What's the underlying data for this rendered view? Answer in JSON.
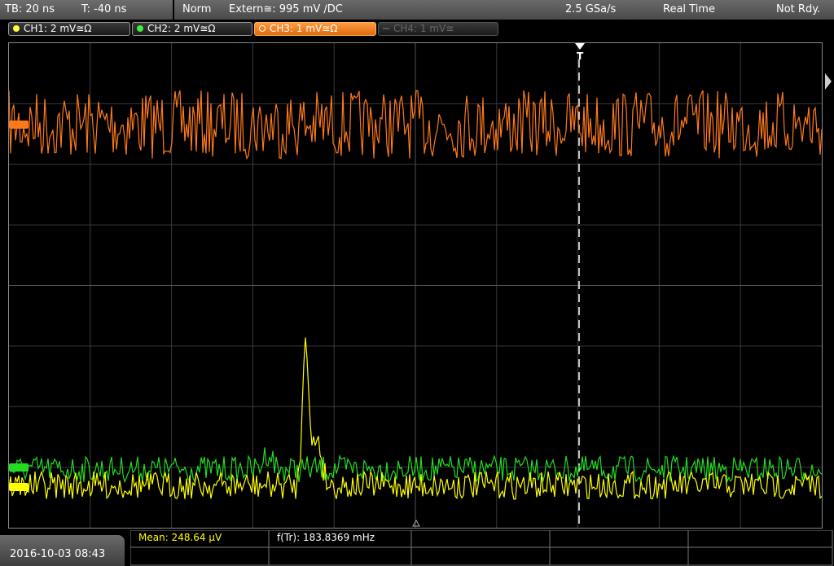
{
  "status_bar": {
    "timebase": "TB: 20 ns",
    "trigger_time": "T: -40 ns",
    "trigger_mode": "Norm",
    "trigger_source": "Extern≅: 995 mV ∕DC",
    "sample_rate": "2.5 GSa/s",
    "acq_mode": "Real Time",
    "trigger_state": "Not Rdy."
  },
  "channels": [
    {
      "label": "CH1: 2 mV≅Ω",
      "color": "#ffff00",
      "state": "on"
    },
    {
      "label": "CH2: 2 mV≅Ω",
      "color": "#22dd22",
      "state": "on"
    },
    {
      "label": "CH3: 1 mV≅Ω",
      "color": "#ff7a1a",
      "state": "selected"
    },
    {
      "label": "CH4: 1 mV≅",
      "color": "#555555",
      "state": "off"
    }
  ],
  "marker": {
    "trigger_t": "T"
  },
  "measurements": {
    "mean": "Mean: 248.64 µV",
    "freq": "f(Tr): 183.8369 mHz"
  },
  "datetime": "2016-10-03 08:43",
  "colors": {
    "ch1": "#ffff00",
    "ch2": "#22dd22",
    "ch3": "#ff7a1a",
    "grid": "#3a3a3a"
  }
}
